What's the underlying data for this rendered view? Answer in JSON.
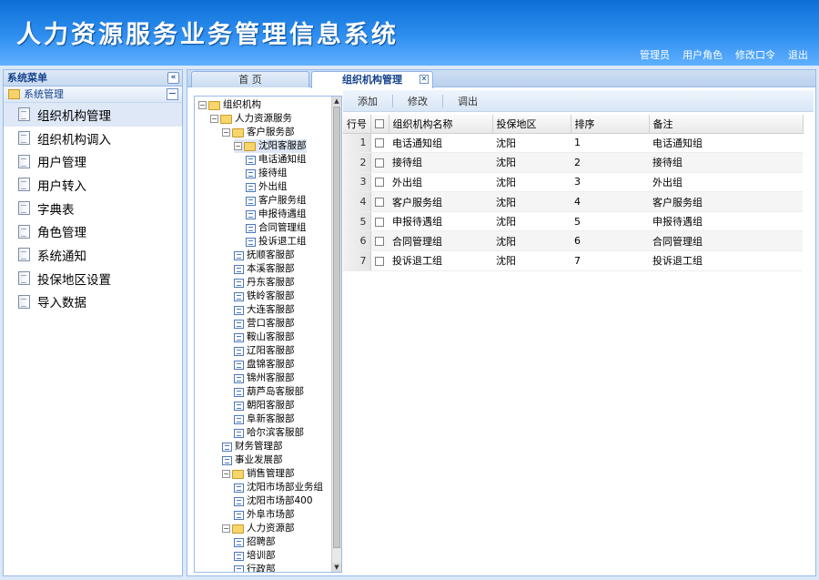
{
  "app": {
    "title": "人力资源服务业务管理信息系统"
  },
  "topnav": [
    "管理员",
    "用户角色",
    "修改口令",
    "退出"
  ],
  "left": {
    "panel_title": "系统菜单",
    "group": "系统管理",
    "items": [
      "组织机构管理",
      "组织机构调入",
      "用户管理",
      "用户转入",
      "字典表",
      "角色管理",
      "系统通知",
      "投保地区设置",
      "导入数据"
    ],
    "active_index": 0
  },
  "tabs": {
    "home": "首  页",
    "current": "组织机构管理"
  },
  "tree": [
    {
      "label": "组织机构",
      "depth": 0,
      "kind": "folder",
      "toggle": "−"
    },
    {
      "label": "人力资源服务",
      "depth": 1,
      "kind": "folder",
      "toggle": "−"
    },
    {
      "label": "客户服务部",
      "depth": 2,
      "kind": "folder",
      "toggle": "−"
    },
    {
      "label": "沈阳客服部",
      "depth": 3,
      "kind": "folder",
      "toggle": "−",
      "selected": true
    },
    {
      "label": "电话通知组",
      "depth": 4,
      "kind": "leaf"
    },
    {
      "label": "接待组",
      "depth": 4,
      "kind": "leaf"
    },
    {
      "label": "外出组",
      "depth": 4,
      "kind": "leaf"
    },
    {
      "label": "客户服务组",
      "depth": 4,
      "kind": "leaf"
    },
    {
      "label": "申报待遇组",
      "depth": 4,
      "kind": "leaf"
    },
    {
      "label": "合同管理组",
      "depth": 4,
      "kind": "leaf"
    },
    {
      "label": "投诉退工组",
      "depth": 4,
      "kind": "leaf"
    },
    {
      "label": "抚顺客服部",
      "depth": 3,
      "kind": "leaf"
    },
    {
      "label": "本溪客服部",
      "depth": 3,
      "kind": "leaf"
    },
    {
      "label": "丹东客服部",
      "depth": 3,
      "kind": "leaf"
    },
    {
      "label": "铁岭客服部",
      "depth": 3,
      "kind": "leaf"
    },
    {
      "label": "大连客服部",
      "depth": 3,
      "kind": "leaf"
    },
    {
      "label": "营口客服部",
      "depth": 3,
      "kind": "leaf"
    },
    {
      "label": "鞍山客服部",
      "depth": 3,
      "kind": "leaf"
    },
    {
      "label": "辽阳客服部",
      "depth": 3,
      "kind": "leaf"
    },
    {
      "label": "盘锦客服部",
      "depth": 3,
      "kind": "leaf"
    },
    {
      "label": "锦州客服部",
      "depth": 3,
      "kind": "leaf"
    },
    {
      "label": "葫芦岛客服部",
      "depth": 3,
      "kind": "leaf"
    },
    {
      "label": "朝阳客服部",
      "depth": 3,
      "kind": "leaf"
    },
    {
      "label": "阜新客服部",
      "depth": 3,
      "kind": "leaf"
    },
    {
      "label": "哈尔滨客服部",
      "depth": 3,
      "kind": "leaf"
    },
    {
      "label": "财务管理部",
      "depth": 2,
      "kind": "leaf"
    },
    {
      "label": "事业发展部",
      "depth": 2,
      "kind": "leaf"
    },
    {
      "label": "销售管理部",
      "depth": 2,
      "kind": "folder",
      "toggle": "−"
    },
    {
      "label": "沈阳市场部业务组",
      "depth": 3,
      "kind": "leaf"
    },
    {
      "label": "沈阳市场部400",
      "depth": 3,
      "kind": "leaf"
    },
    {
      "label": "外阜市场部",
      "depth": 3,
      "kind": "leaf"
    },
    {
      "label": "人力资源部",
      "depth": 2,
      "kind": "folder",
      "toggle": "−"
    },
    {
      "label": "招聘部",
      "depth": 3,
      "kind": "leaf"
    },
    {
      "label": "培训部",
      "depth": 3,
      "kind": "leaf"
    },
    {
      "label": "行政部",
      "depth": 3,
      "kind": "leaf"
    }
  ],
  "toolbar": {
    "add": "添加",
    "edit": "修改",
    "out": "调出"
  },
  "grid": {
    "columns": [
      "行号",
      "组织机构名称",
      "投保地区",
      "排序",
      "备注"
    ],
    "rows": [
      [
        "1",
        "电话通知组",
        "沈阳",
        "1",
        "电话通知组"
      ],
      [
        "2",
        "接待组",
        "沈阳",
        "2",
        "接待组"
      ],
      [
        "3",
        "外出组",
        "沈阳",
        "3",
        "外出组"
      ],
      [
        "4",
        "客户服务组",
        "沈阳",
        "4",
        "客户服务组"
      ],
      [
        "5",
        "申报待遇组",
        "沈阳",
        "5",
        "申报待遇组"
      ],
      [
        "6",
        "合同管理组",
        "沈阳",
        "6",
        "合同管理组"
      ],
      [
        "7",
        "投诉退工组",
        "沈阳",
        "7",
        "投诉退工组"
      ]
    ]
  }
}
